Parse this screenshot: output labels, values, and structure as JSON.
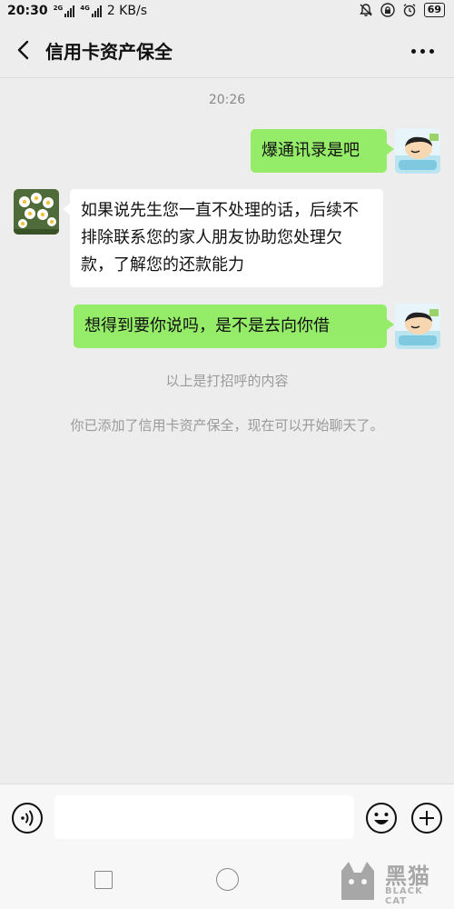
{
  "status_bar": {
    "time": "20:30",
    "network_speed": "2 KB/s",
    "sim1_tag": "2G",
    "sim2_tag": "4G",
    "battery": "69"
  },
  "header": {
    "title": "信用卡资产保全"
  },
  "chat": {
    "timestamp": "20:26",
    "messages": [
      {
        "from": "me",
        "text": "爆通讯录是吧"
      },
      {
        "from": "other",
        "text": "如果说先生您一直不处理的话，后续不排除联系您的家人朋友协助您处理欠款，了解您的还款能力"
      },
      {
        "from": "me",
        "text": "想得到要你说吗，是不是去向你借"
      }
    ],
    "system_messages": [
      "以上是打招呼的内容",
      "你已添加了信用卡资产保全，现在可以开始聊天了。"
    ]
  },
  "input_bar": {
    "value": ""
  },
  "watermark": {
    "text_cn": "黑猫",
    "text_en": "BLACK CAT"
  },
  "colors": {
    "my_bubble": "#95ec69",
    "other_bubble": "#ffffff",
    "background": "#ededed"
  },
  "icons": {
    "back": "back-arrow-icon",
    "more": "more-dots-icon",
    "voice": "voice-icon",
    "emoji": "emoji-icon",
    "plus": "plus-icon"
  }
}
